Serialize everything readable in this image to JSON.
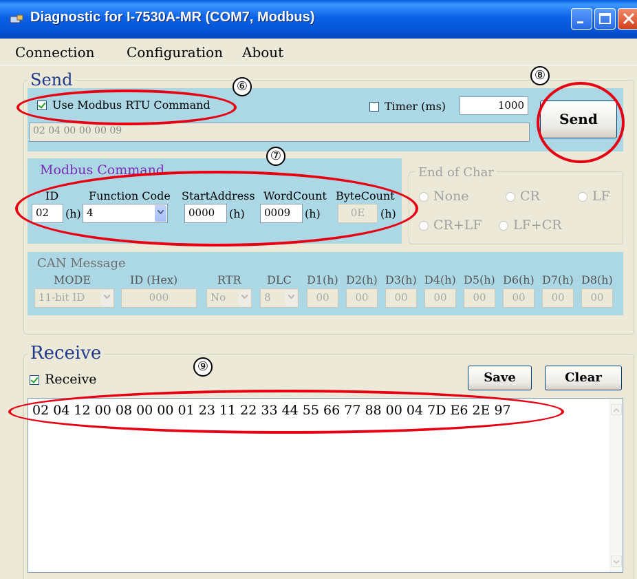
{
  "window": {
    "title": "Diagnostic for I-7530A-MR (COM7, Modbus)"
  },
  "menu": {
    "connection": "Connection",
    "configuration": "Configuration",
    "about": "About"
  },
  "send": {
    "group_title": "Send",
    "use_rtu_label": "Use Modbus RTU Command",
    "use_rtu_checked": true,
    "timer_label": "Timer (ms)",
    "timer_checked": false,
    "timer_value": "1000",
    "command_text": "02 04 00 00 00 09",
    "send_button": "Send"
  },
  "modbus": {
    "title": "Modbus Command",
    "id_label": "ID",
    "function_code_label": "Function Code",
    "start_address_label": "StartAddress",
    "word_count_label": "WordCount",
    "byte_count_label": "ByteCount",
    "id_value": "02",
    "function_code_value": "4",
    "start_address_value": "0000",
    "word_count_value": "0009",
    "byte_count_value": "0E",
    "hex_suffix": "(h)"
  },
  "end_of_char": {
    "title": "End of Char",
    "options": [
      "None",
      "CR",
      "LF",
      "CR+LF",
      "LF+CR"
    ]
  },
  "can": {
    "title": "CAN Message",
    "headers": [
      "MODE",
      "ID (Hex)",
      "RTR",
      "DLC",
      "D1(h)",
      "D2(h)",
      "D3(h)",
      "D4(h)",
      "D5(h)",
      "D6(h)",
      "D7(h)",
      "D8(h)"
    ],
    "mode_value": "11-bit ID",
    "id_value": "000",
    "rtr_value": "No",
    "dlc_value": "8",
    "data_values": [
      "00",
      "00",
      "00",
      "00",
      "00",
      "00",
      "00",
      "00"
    ]
  },
  "receive": {
    "group_title": "Receive",
    "checkbox_label": "Receive",
    "checked": true,
    "save_button": "Save",
    "clear_button": "Clear",
    "text": "02 04 12 00 08 00 00 01 23 11 22 33 44 55 66 77 88 00 04 7D E6 2E 97"
  },
  "annotations": [
    "⑥",
    "⑦",
    "⑧",
    "⑨"
  ],
  "colors": {
    "annotation": "#e60012",
    "panel": "#acd8e6",
    "titlebar": "#0b62e6"
  }
}
